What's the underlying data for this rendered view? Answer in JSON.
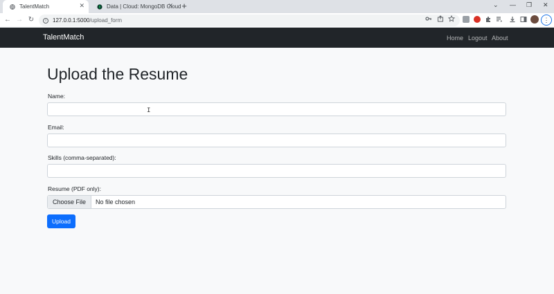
{
  "browser": {
    "tabs": [
      {
        "title": "TalentMatch",
        "active": true,
        "close": "✕"
      },
      {
        "title": "Data | Cloud: MongoDB Cloud",
        "active": false,
        "close": "✕"
      }
    ],
    "new_tab": "+",
    "window_controls": {
      "chevron": "⌄",
      "minimize": "—",
      "restore": "❐",
      "close": "✕"
    },
    "nav": {
      "back": "←",
      "forward": "→",
      "reload": "↻"
    },
    "address": {
      "host": "127.0.0.1:5000",
      "path": "/upload_form"
    },
    "omnibox_icons": [
      "key-icon",
      "share-icon",
      "star-icon"
    ],
    "extensions": [
      "extension-1-icon",
      "extension-2-icon",
      "puzzle-icon",
      "reading-list-icon",
      "download-icon",
      "side-panel-icon"
    ],
    "menu": "⋮"
  },
  "navbar": {
    "brand": "TalentMatch",
    "links": [
      "Home",
      "Logout",
      "About"
    ]
  },
  "form": {
    "heading": "Upload the Resume",
    "name_label": "Name:",
    "name_value": "",
    "email_label": "Email:",
    "email_value": "",
    "skills_label": "Skills (comma-separated):",
    "skills_value": "",
    "resume_label": "Resume (PDF only):",
    "choose_file": "Choose File",
    "file_status": "No file chosen",
    "submit": "Upload"
  },
  "colors": {
    "navbar": "#212529",
    "primary": "#0d6efd",
    "page_bg": "#f8f9fa"
  }
}
